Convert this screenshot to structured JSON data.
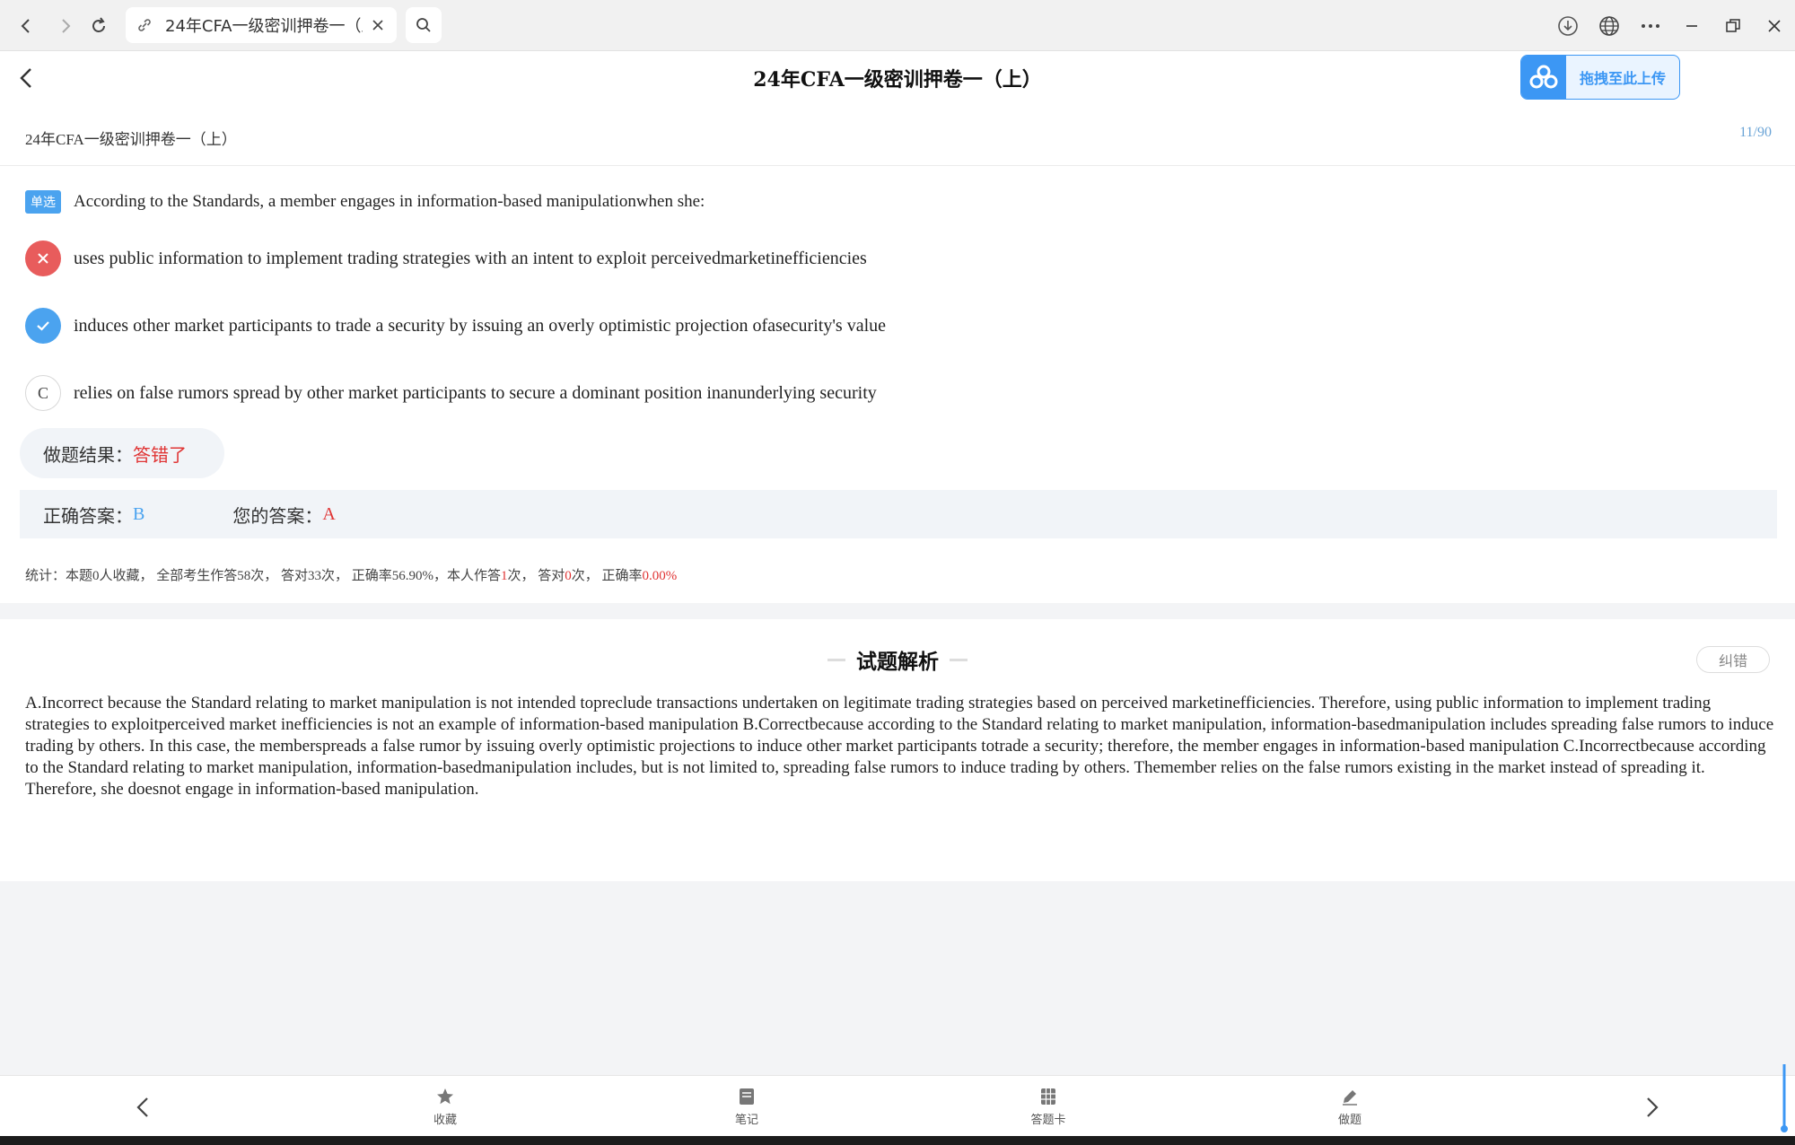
{
  "browser": {
    "tab_title": "24年CFA一级密训押卷一（上）",
    "icons": {
      "back": "chevron-left-icon",
      "forward": "chevron-right-icon",
      "reload": "reload-icon",
      "link": "link-icon",
      "close": "close-icon",
      "search": "search-icon",
      "download": "download-icon",
      "globe": "globe-icon",
      "more": "more-icon",
      "minimize": "minimize-icon",
      "restore": "restore-icon",
      "window_close": "window-close-icon"
    }
  },
  "header": {
    "title": "24年CFA一级密训押卷一（上）",
    "upload_label": "拖拽至此上传",
    "subtitle": "24年CFA一级密训押卷一（上）",
    "counter": "11/90"
  },
  "question": {
    "type_badge": "单选",
    "text": "According to the Standards, a member engages in information-based manipulationwhen she:",
    "options": [
      {
        "status": "wrong",
        "text": "uses public information to implement trading strategies with an intent to exploit perceivedmarketinefficiencies"
      },
      {
        "status": "correct",
        "text": "induces other market participants to trade a security by issuing an overly optimistic projection ofasecurity's value"
      },
      {
        "status": "plain",
        "letter": "C",
        "text": "relies on false rumors spread by other market participants to secure a dominant position inanunderlying security"
      }
    ]
  },
  "result": {
    "label": "做题结果：",
    "value": "答错了"
  },
  "answers": {
    "correct_label": "正确答案：",
    "correct_value": "B",
    "mine_label": "您的答案：",
    "mine_value": "A"
  },
  "stats": {
    "prefix": "统计：本题0人收藏， 全部考生作答58次， 答对33次， 正确率56.90%，本人作答",
    "self_count": "1",
    "mid1": "次， 答对",
    "self_correct": "0",
    "mid2": "次， 正确率",
    "self_rate": "0.00%"
  },
  "analysis": {
    "title": "试题解析",
    "correction_label": "纠错",
    "body": "A.Incorrect because the Standard relating to market manipulation is not intended topreclude transactions undertaken on legitimate trading strategies based on perceived marketinefficiencies. Therefore, using public information to implement trading strategies to exploitperceived market inefficiencies is not an example of information-based manipulation B.Correctbecause according to the Standard relating to market manipulation, information-basedmanipulation includes spreading false rumors to induce trading by others. In this case, the memberspreads a false rumor by issuing overly optimistic projections to induce other market participants totrade a security; therefore, the member engages in information-based manipulation C.Incorrectbecause according to the Standard relating to market manipulation, information-basedmanipulation includes, but is not limited to, spreading false rumors to induce trading by others. Themember relies on the false rumors existing in the market instead of spreading it. Therefore, she doesnot engage in information-based manipulation."
  },
  "toolbar": {
    "items": [
      {
        "label": "收藏",
        "icon": "star-icon"
      },
      {
        "label": "笔记",
        "icon": "note-icon"
      },
      {
        "label": "答题卡",
        "icon": "grid-icon"
      },
      {
        "label": "做题",
        "icon": "pencil-icon"
      }
    ]
  },
  "colors": {
    "accent": "#4ba3ef",
    "wrong": "#e85c5c",
    "error_text": "#e03434",
    "panel_bg": "#f1f4f8"
  }
}
